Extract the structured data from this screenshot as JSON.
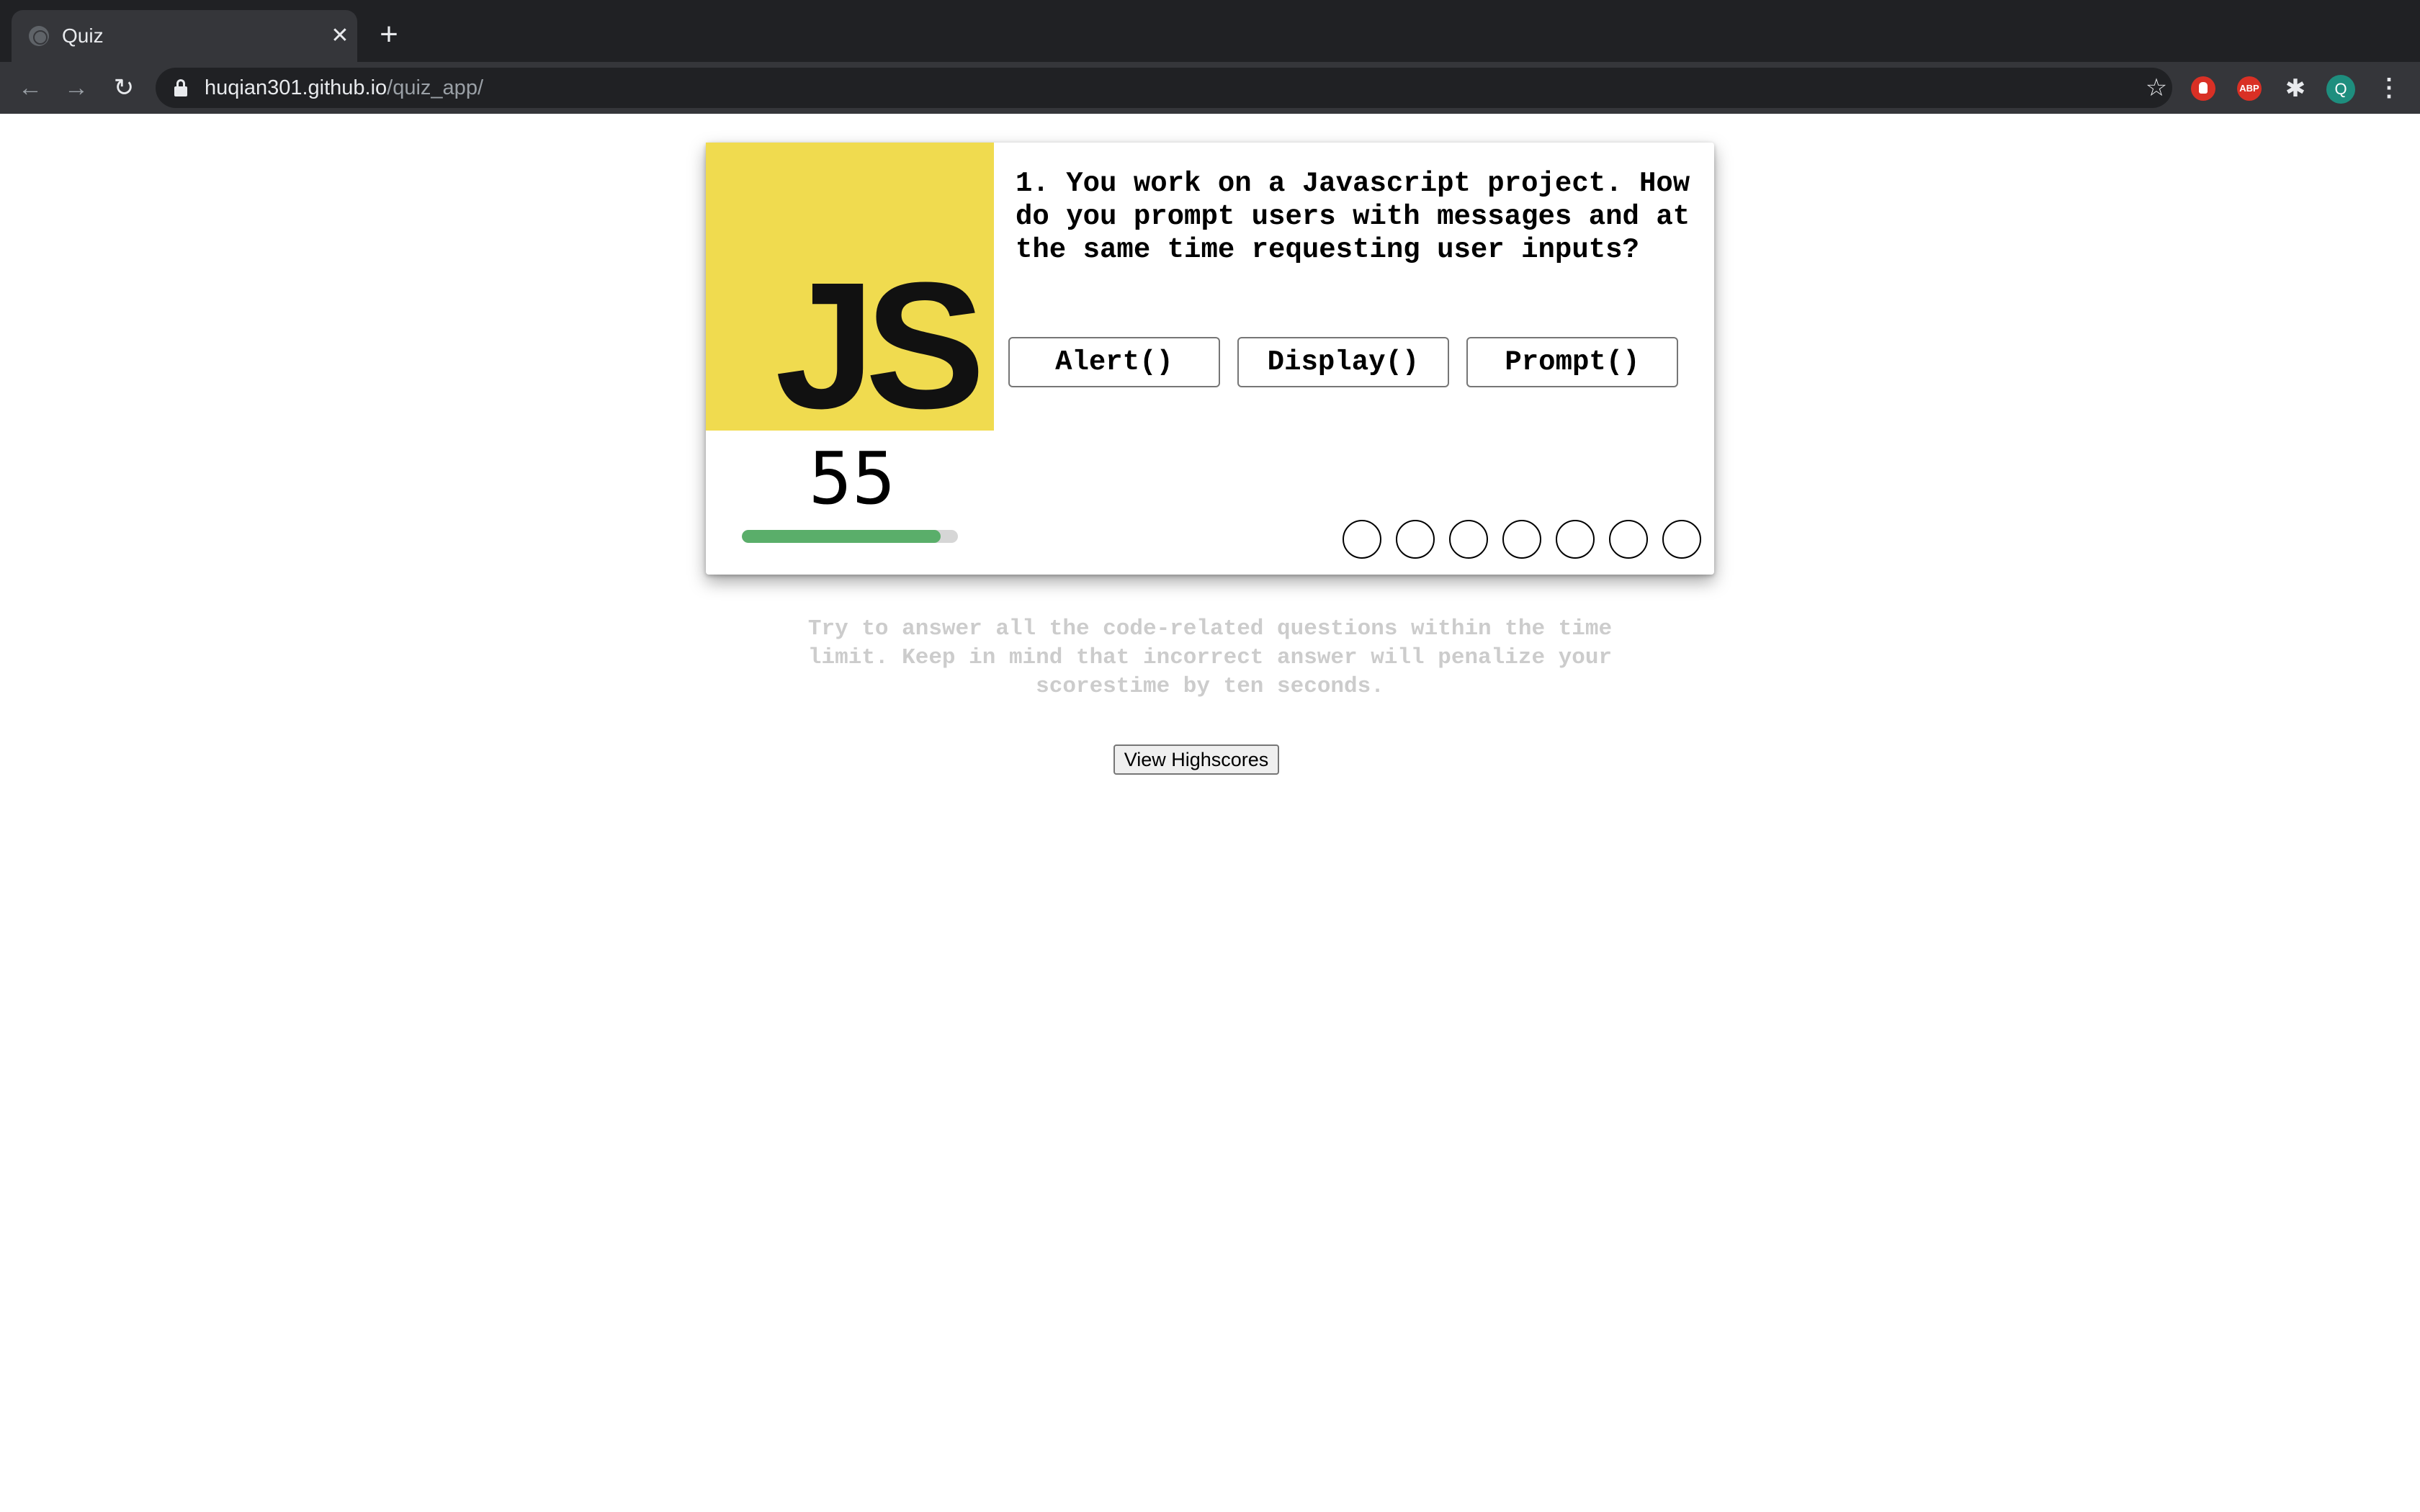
{
  "browser": {
    "tab_title": "Quiz",
    "tab_close_glyph": "✕",
    "new_tab_glyph": "+",
    "url_host": "huqian301.github.io",
    "url_path": "/quiz_app/",
    "back_glyph": "←",
    "forward_glyph": "→",
    "reload_glyph": "↻",
    "star_glyph": "☆",
    "extensions": [
      "adblock-icon",
      "abp-icon",
      "puzzle-icon"
    ],
    "abp_label": "ABP",
    "profile_initial": "Q",
    "menu_glyph": "⋮"
  },
  "quiz": {
    "logo_text": "JS",
    "question": "1. You work on a Javascript project. How do you prompt users with messages and at the same time requesting user inputs?",
    "choices": [
      "Alert()",
      "Display()",
      "Prompt()"
    ],
    "timer": "55",
    "timer_fraction": 0.92,
    "progress_dots": 7,
    "colors": {
      "logo_bg": "#f0db4f",
      "timer_fill": "#5aae6a",
      "timer_track": "#d6d6d6"
    }
  },
  "page": {
    "instructions": "Try to answer all the code-related questions within the time limit. Keep in mind that incorrect answer will penalize your scorestime by ten seconds.",
    "highscores_label": "View Highscores"
  }
}
